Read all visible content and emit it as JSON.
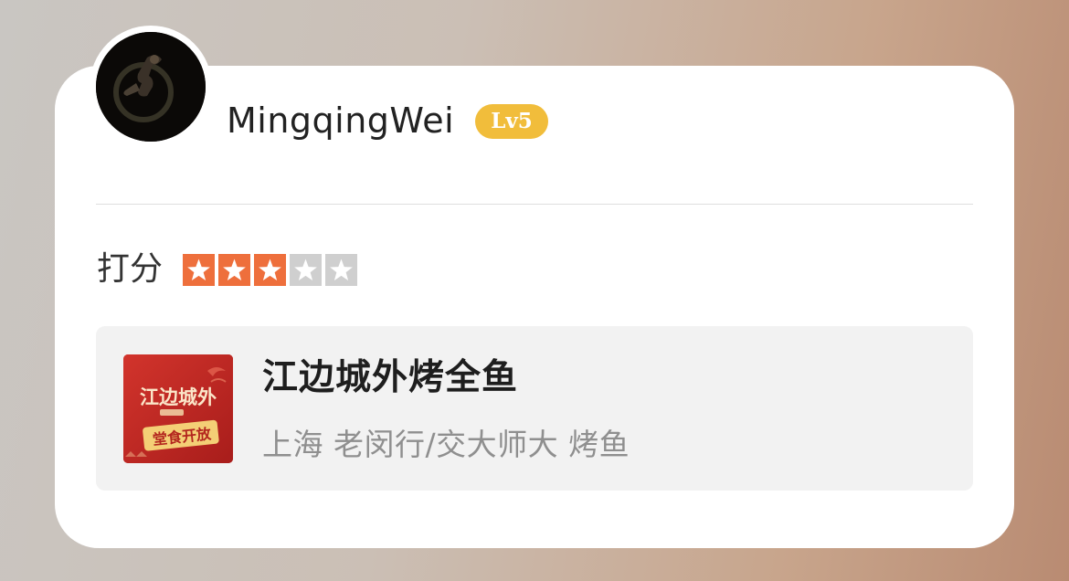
{
  "user": {
    "name": "MingqingWei",
    "level_badge": "Lv5",
    "avatar_icon": "moon-astronaut-avatar"
  },
  "rating": {
    "label": "打分",
    "value": 3,
    "max": 5,
    "star_color_on": "#ee6f3c",
    "star_color_off": "#cfcfcf"
  },
  "shop": {
    "name": "江边城外烤全鱼",
    "meta": "上海 老闵行/交大师大 烤鱼",
    "thumb_text_logo": "江边城外",
    "thumb_text_banner": "堂食开放"
  },
  "colors": {
    "level_badge": "#f1bd3b",
    "card_bg": "#ffffff",
    "shop_card_bg": "#f2f2f2"
  }
}
